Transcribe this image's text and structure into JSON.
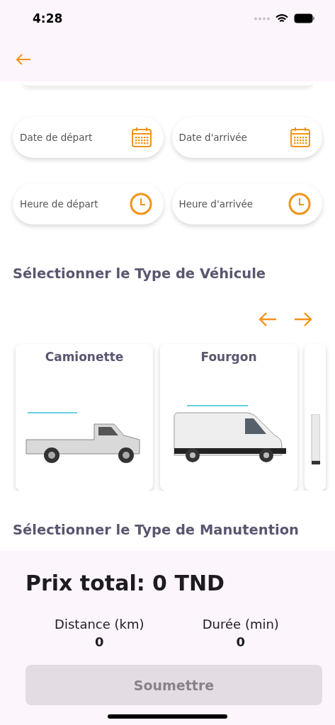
{
  "status_bar": {
    "time": "4:28"
  },
  "fields": [
    {
      "placeholder": "Date de départ",
      "kind": "date"
    },
    {
      "placeholder": "Date d'arrivée",
      "kind": "date"
    },
    {
      "placeholder": "Heure de départ",
      "kind": "time"
    },
    {
      "placeholder": "Heure d'arrivée",
      "kind": "time"
    }
  ],
  "vehicle_section": {
    "title": "Sélectionner le Type de Véhicule"
  },
  "vehicles": [
    {
      "name": "Camionette",
      "kind": "pickup"
    },
    {
      "name": "Fourgon",
      "kind": "van"
    },
    {
      "kind": "box-truck"
    }
  ],
  "handling_section": {
    "title": "Sélectionner le Type de Manutention"
  },
  "summary": {
    "total": "Prix total: 0 TND",
    "stats": [
      {
        "label": "Distance (km)",
        "value": "0"
      },
      {
        "label": "Durée (min)",
        "value": "0"
      }
    ]
  },
  "submit": {
    "label": "Soumettre",
    "disabled": true
  }
}
